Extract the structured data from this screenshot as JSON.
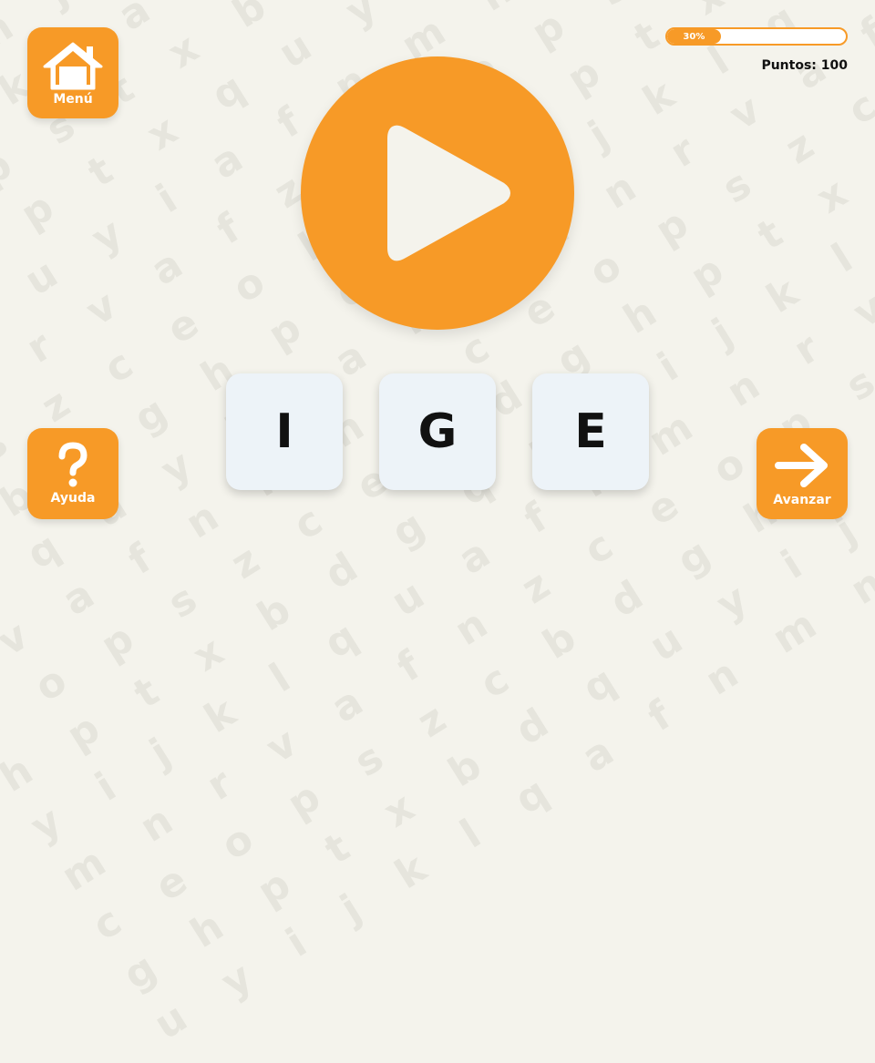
{
  "buttons": {
    "menu": {
      "label": "Menú",
      "icon": "home-icon"
    },
    "help": {
      "label": "Ayuda",
      "icon": "question-mark-icon"
    },
    "next": {
      "label": "Avanzar",
      "icon": "arrow-right-icon"
    }
  },
  "progress": {
    "value": 0.3,
    "label": "30%"
  },
  "score": {
    "text": "Puntos: 100"
  },
  "play": {
    "icon": "play-icon"
  },
  "tiles": [
    {
      "letter": "I"
    },
    {
      "letter": "G"
    },
    {
      "letter": "E"
    }
  ],
  "colors": {
    "accent": "#f79a27",
    "background": "#f4f3ec",
    "tile": "#edf3f8",
    "text": "#111111",
    "icon": "#ffffff"
  }
}
